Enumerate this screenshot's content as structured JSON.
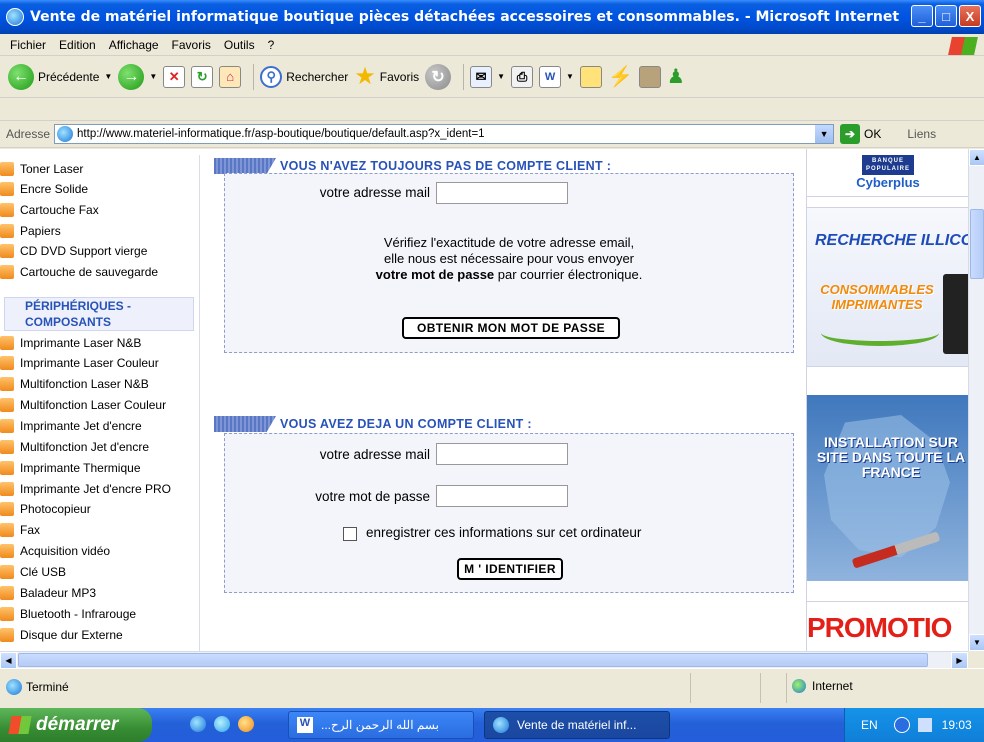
{
  "window": {
    "title": "Vente de matériel informatique boutique pièces détachées accessoires et consommables. - Microsoft Internet ...",
    "min_label": "_",
    "max_label": "□",
    "close_label": "X"
  },
  "menu": [
    "Fichier",
    "Edition",
    "Affichage",
    "Favoris",
    "Outils",
    "?"
  ],
  "toolbar": {
    "back_label": "Précédente",
    "search_label": "Rechercher",
    "favorites_label": "Favoris"
  },
  "address": {
    "label": "Adresse",
    "url": "http://www.materiel-informatique.fr/asp-boutique/boutique/default.asp?x_ident=1",
    "go_label": "OK",
    "links_label": "Liens"
  },
  "sidebar": {
    "items_top": [
      "Toner Laser",
      "Encre Solide",
      "Cartouche Fax",
      "Papiers",
      "CD DVD Support vierge",
      "Cartouche de sauvegarde"
    ],
    "section_title": "PÉRIPHÉRIQUES - COMPOSANTS",
    "items_bottom": [
      "Imprimante Laser N&B",
      "Imprimante Laser Couleur",
      "Multifonction Laser N&B",
      "Multifonction Laser Couleur",
      "Imprimante Jet d'encre",
      "Multifonction Jet d'encre",
      "Imprimante Thermique",
      "Imprimante Jet d'encre PRO",
      "Photocopieur",
      "Fax",
      "Acquisition vidéo",
      "Clé USB",
      "Baladeur MP3",
      "Bluetooth - Infrarouge",
      "Disque dur Externe"
    ]
  },
  "new_account": {
    "heading": "VOUS N'AVEZ TOUJOURS PAS DE COMPTE CLIENT :",
    "email_label": "votre adresse mail",
    "email_value": "",
    "note_line1": "Vérifiez l'exactitude de votre adresse email,",
    "note_line2": "elle nous est nécessaire pour vous envoyer",
    "note_bold": "votre mot de passe",
    "note_tail": " par courrier électronique.",
    "button": "OBTENIR MON MOT DE PASSE"
  },
  "existing_account": {
    "heading": "VOUS AVEZ DEJA UN COMPTE CLIENT :",
    "email_label": "votre adresse mail",
    "email_value": "",
    "password_label": "votre mot de passe",
    "password_value": "",
    "remember_label": "enregistrer ces informations sur cet ordinateur",
    "remember_checked": false,
    "button": "M ' IDENTIFIER"
  },
  "ads": {
    "bank_line1": "BANQUE",
    "bank_line2": "POPULAIRE",
    "bank_name": "Cyberplus",
    "search_banner": "RECHERCHE ILLICO",
    "consumables": "CONSOMMABLES IMPRIMANTES",
    "install": "INSTALLATION SUR SITE DANS TOUTE LA FRANCE",
    "promo": "PROMOTIO"
  },
  "status": {
    "text": "Terminé",
    "zone": "Internet"
  },
  "taskbar": {
    "start_label": "démarrer",
    "task1": "...بسم الله الرحمن الرح",
    "task2": "Vente de matériel inf...",
    "lang": "EN",
    "clock": "19:03"
  }
}
